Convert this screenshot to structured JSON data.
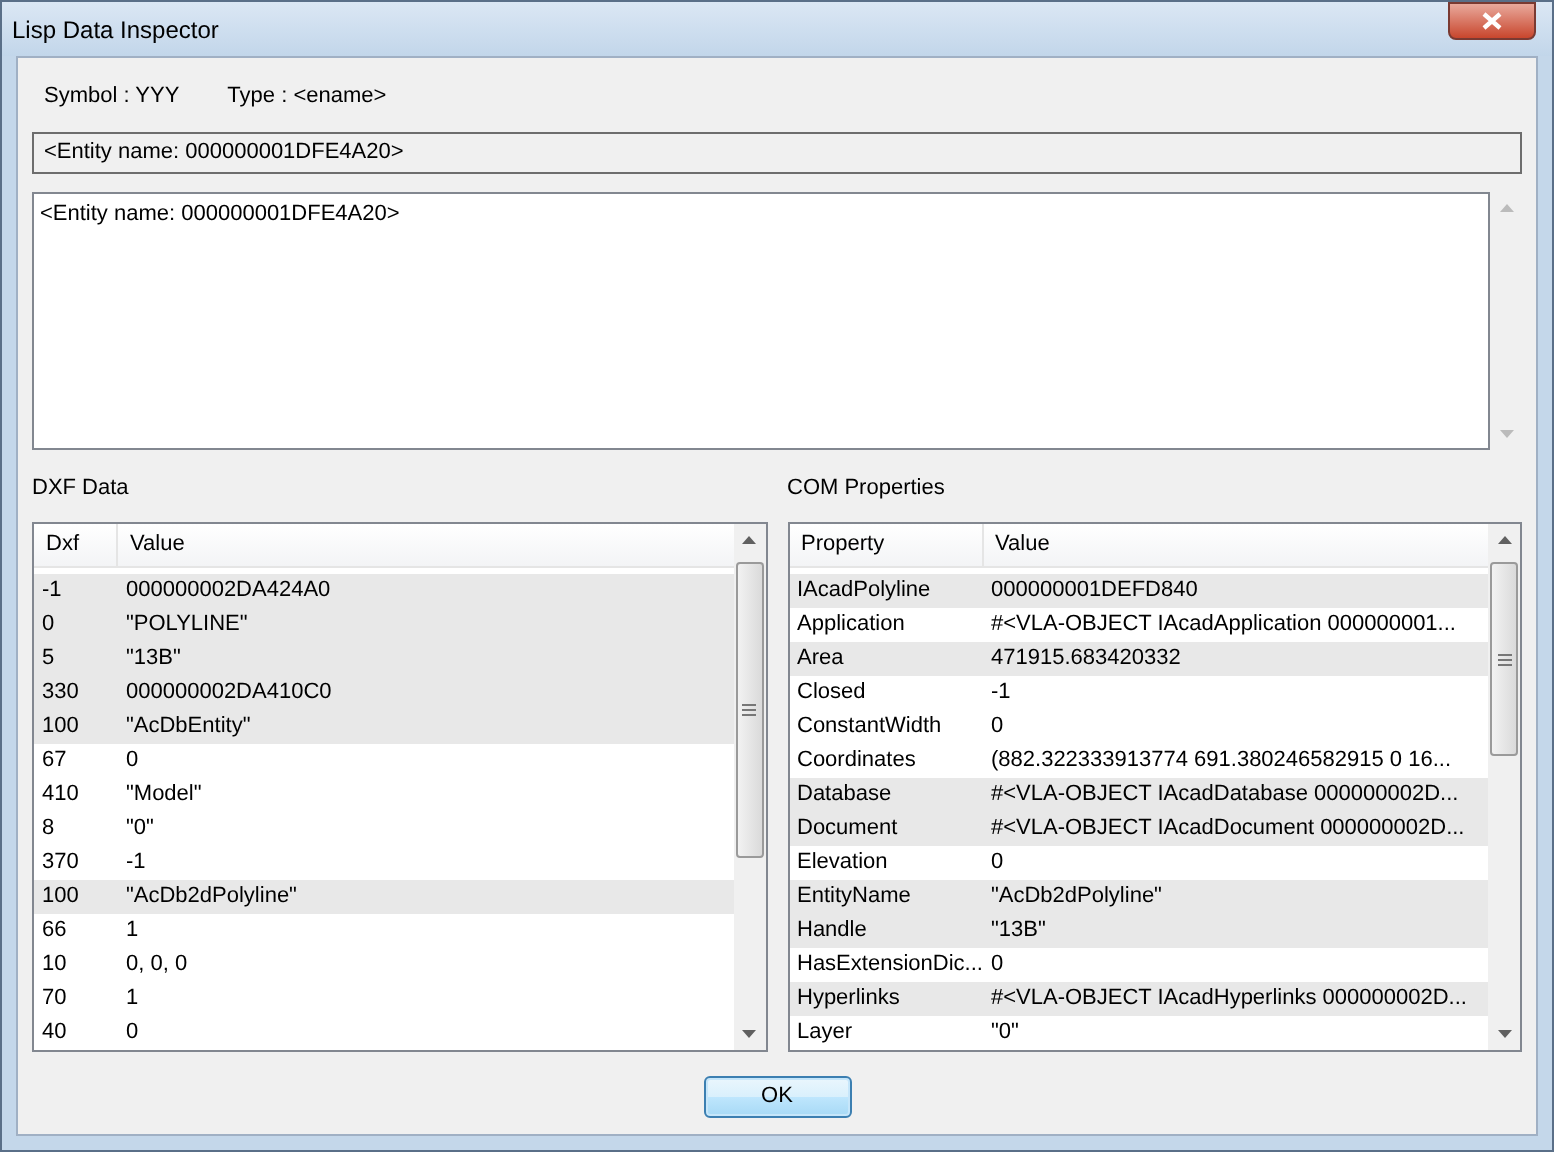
{
  "window": {
    "title": "Lisp Data Inspector"
  },
  "symbol": "Symbol : YYY",
  "type": "Type : <ename>",
  "value_field": "<Entity name: 000000001DFE4A20>",
  "detail_text": "<Entity name: 000000001DFE4A20>",
  "dxf": {
    "label": "DXF Data",
    "columns": [
      "Dxf",
      "Value"
    ],
    "rows": [
      {
        "cells": [
          "-1",
          "000000002DA424A0"
        ],
        "shaded": true
      },
      {
        "cells": [
          "0",
          "\"POLYLINE\""
        ],
        "shaded": true
      },
      {
        "cells": [
          "5",
          "\"13B\""
        ],
        "shaded": true
      },
      {
        "cells": [
          "330",
          "000000002DA410C0"
        ],
        "shaded": true
      },
      {
        "cells": [
          "100",
          "\"AcDbEntity\""
        ],
        "shaded": true
      },
      {
        "cells": [
          "67",
          "0"
        ],
        "shaded": false
      },
      {
        "cells": [
          "410",
          "\"Model\""
        ],
        "shaded": false
      },
      {
        "cells": [
          "8",
          "\"0\""
        ],
        "shaded": false
      },
      {
        "cells": [
          "370",
          "-1"
        ],
        "shaded": false
      },
      {
        "cells": [
          "100",
          "\"AcDb2dPolyline\""
        ],
        "shaded": true
      },
      {
        "cells": [
          "66",
          "1"
        ],
        "shaded": false
      },
      {
        "cells": [
          "10",
          "0, 0, 0"
        ],
        "shaded": false
      },
      {
        "cells": [
          "70",
          "1"
        ],
        "shaded": false
      },
      {
        "cells": [
          "40",
          "0"
        ],
        "shaded": false
      }
    ]
  },
  "com": {
    "label": "COM Properties",
    "columns": [
      "Property",
      "Value"
    ],
    "rows": [
      {
        "cells": [
          "IAcadPolyline",
          "000000001DEFD840"
        ],
        "shaded": true
      },
      {
        "cells": [
          "Application",
          "#<VLA-OBJECT IAcadApplication 000000001..."
        ],
        "shaded": false
      },
      {
        "cells": [
          "Area",
          "471915.683420332"
        ],
        "shaded": true
      },
      {
        "cells": [
          "Closed",
          "-1"
        ],
        "shaded": false
      },
      {
        "cells": [
          "ConstantWidth",
          "0"
        ],
        "shaded": false
      },
      {
        "cells": [
          "Coordinates",
          "(882.322333913774 691.380246582915 0 16..."
        ],
        "shaded": false
      },
      {
        "cells": [
          "Database",
          "#<VLA-OBJECT IAcadDatabase 000000002D..."
        ],
        "shaded": true
      },
      {
        "cells": [
          "Document",
          "#<VLA-OBJECT IAcadDocument 000000002D..."
        ],
        "shaded": true
      },
      {
        "cells": [
          "Elevation",
          "0"
        ],
        "shaded": false
      },
      {
        "cells": [
          "EntityName",
          "\"AcDb2dPolyline\""
        ],
        "shaded": true
      },
      {
        "cells": [
          "Handle",
          "\"13B\""
        ],
        "shaded": true
      },
      {
        "cells": [
          "HasExtensionDic...",
          "0"
        ],
        "shaded": false
      },
      {
        "cells": [
          "Hyperlinks",
          "#<VLA-OBJECT IAcadHyperlinks 000000002D..."
        ],
        "shaded": true
      },
      {
        "cells": [
          "Layer",
          "\"0\""
        ],
        "shaded": false
      }
    ]
  },
  "buttons": [
    "OK"
  ]
}
